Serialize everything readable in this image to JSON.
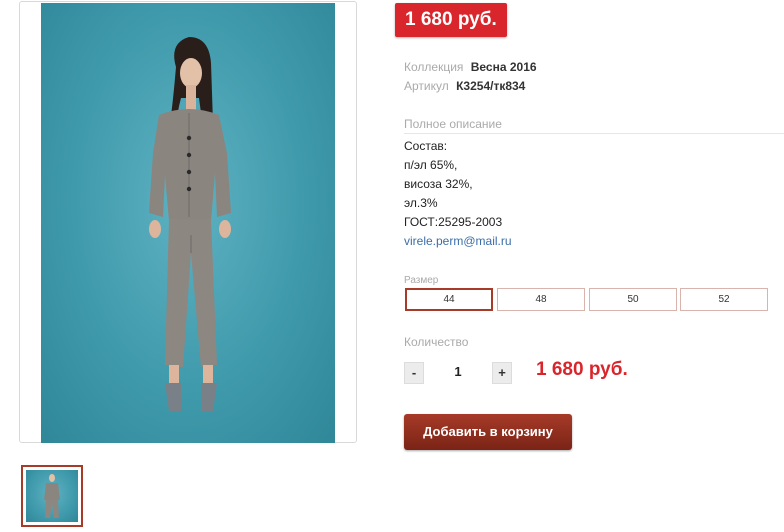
{
  "price": "1 680 руб.",
  "product": {
    "collection_label": "Коллекция",
    "collection_value": "Весна 2016",
    "article_label": "Артикул",
    "article_value": "К3254/тк834"
  },
  "description": {
    "title": "Полное описание",
    "lines": [
      "Состав:",
      "п/эл 65%,",
      "висоза 32%,",
      "эл.3%",
      "ГОСТ:25295-2003"
    ],
    "email": "virele.perm@mail.ru"
  },
  "sizes": {
    "label": "Размер",
    "options": [
      "44",
      "48",
      "50",
      "52"
    ],
    "selected": "44"
  },
  "quantity": {
    "label": "Количество",
    "minus": "-",
    "value": "1",
    "plus": "+"
  },
  "total": "1 680 руб.",
  "cart_button": "Добавить в корзину",
  "colors": {
    "price_red": "#d9262c",
    "accent_brown": "#a83a28",
    "photo_bg": "#3f9aab"
  }
}
